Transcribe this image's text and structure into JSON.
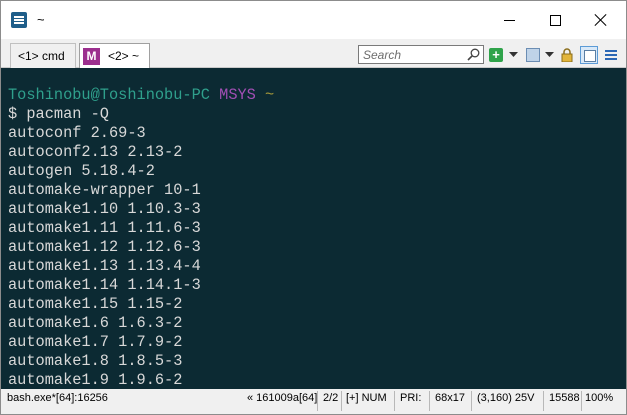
{
  "window": {
    "title": "~"
  },
  "tabs": [
    {
      "label": "<1> cmd"
    },
    {
      "icon_letter": "M",
      "label": "<2> ~"
    }
  ],
  "search": {
    "placeholder": "Search"
  },
  "toolbar_icons": [
    "search-icon",
    "new-console-plus-icon",
    "chevron-down-icon",
    "view-icon",
    "chevron-down-icon",
    "lock-icon",
    "panel-icon",
    "menu-icon"
  ],
  "terminal": {
    "prompt": {
      "user_host": "Toshinobu@Toshinobu-PC",
      "system": "MSYS",
      "path": "~"
    },
    "command": "$ pacman -Q",
    "packages": [
      "autoconf 2.69-3",
      "autoconf2.13 2.13-2",
      "autogen 5.18.4-2",
      "automake-wrapper 10-1",
      "automake1.10 1.10.3-3",
      "automake1.11 1.11.6-3",
      "automake1.12 1.12.6-3",
      "automake1.13 1.13.4-4",
      "automake1.14 1.14.1-3",
      "automake1.15 1.15-2",
      "automake1.6 1.6.3-2",
      "automake1.7 1.7.9-2",
      "automake1.8 1.8.5-3",
      "automake1.9 1.9.6-2"
    ]
  },
  "statusbar": {
    "process": "bash.exe*[64]:16256",
    "build": "« 161009a[64]",
    "console": "2/2",
    "keys": "[+] NUM",
    "pri": "PRI:",
    "size": "68x17",
    "cursor": "(3,160) 25V",
    "pid": "15588",
    "zoom": "100%"
  },
  "colors": {
    "terminal_bg": "#0c2a33",
    "terminal_fg": "#d8d8d8",
    "prompt_user": "#2fa08c",
    "prompt_system": "#a24fb5",
    "prompt_path": "#a89a3a",
    "msys_tab_icon": "#9c2f8e"
  }
}
